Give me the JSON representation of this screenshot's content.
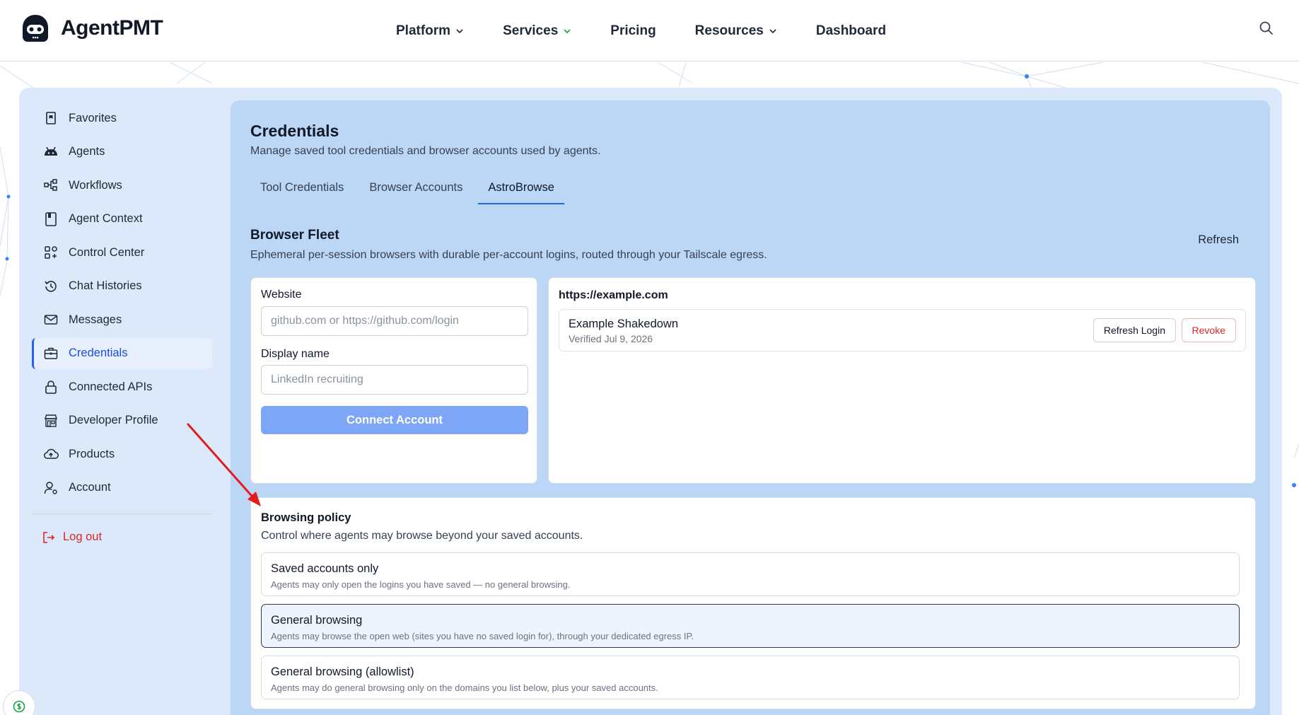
{
  "brand": {
    "name": "AgentPMT"
  },
  "nav": {
    "items": [
      {
        "label": "Platform",
        "dropdown": true
      },
      {
        "label": "Services",
        "dropdown": true
      },
      {
        "label": "Pricing",
        "dropdown": false
      },
      {
        "label": "Resources",
        "dropdown": true
      },
      {
        "label": "Dashboard",
        "dropdown": false
      }
    ]
  },
  "sidebar": {
    "items": [
      {
        "label": "Favorites",
        "icon": "bookmark-icon"
      },
      {
        "label": "Agents",
        "icon": "robot-icon"
      },
      {
        "label": "Workflows",
        "icon": "workflow-icon"
      },
      {
        "label": "Agent Context",
        "icon": "document-icon"
      },
      {
        "label": "Control Center",
        "icon": "grid-icon"
      },
      {
        "label": "Chat Histories",
        "icon": "history-icon"
      },
      {
        "label": "Messages",
        "icon": "mail-icon"
      },
      {
        "label": "Credentials",
        "icon": "briefcase-icon",
        "active": true
      },
      {
        "label": "Connected APIs",
        "icon": "lock-icon"
      },
      {
        "label": "Developer Profile",
        "icon": "store-icon"
      },
      {
        "label": "Products",
        "icon": "cloud-upload-icon"
      },
      {
        "label": "Account",
        "icon": "user-gear-icon"
      }
    ],
    "logout_label": "Log out"
  },
  "page": {
    "title": "Credentials",
    "subtitle": "Manage saved tool credentials and browser accounts used by agents.",
    "tabs": [
      {
        "label": "Tool Credentials"
      },
      {
        "label": "Browser Accounts"
      },
      {
        "label": "AstroBrowse",
        "active": true
      }
    ]
  },
  "fleet": {
    "title": "Browser Fleet",
    "subtitle": "Ephemeral per-session browsers with durable per-account logins, routed through your Tailscale egress.",
    "refresh_label": "Refresh"
  },
  "connect": {
    "website_label": "Website",
    "website_placeholder": "github.com or https://github.com/login",
    "display_label": "Display name",
    "display_placeholder": "LinkedIn recruiting",
    "button_label": "Connect Account"
  },
  "accounts": {
    "host": "https://example.com",
    "rows": [
      {
        "name": "Example Shakedown",
        "verified": "Verified Jul 9, 2026",
        "refresh_label": "Refresh Login",
        "revoke_label": "Revoke"
      }
    ]
  },
  "policy": {
    "title": "Browsing policy",
    "subtitle": "Control where agents may browse beyond your saved accounts.",
    "options": [
      {
        "title": "Saved accounts only",
        "desc": "Agents may only open the logins you have saved — no general browsing."
      },
      {
        "title": "General browsing",
        "desc": "Agents may browse the open web (sites you have no saved login for), through your dedicated egress IP.",
        "selected": true
      },
      {
        "title": "General browsing (allowlist)",
        "desc": "Agents may do general browsing only on the domains you list below, plus your saved accounts."
      }
    ]
  },
  "colors": {
    "accent": "#2563eb",
    "danger": "#dc2626",
    "panel": "#bcd6f6",
    "shell": "#dce9fb"
  }
}
